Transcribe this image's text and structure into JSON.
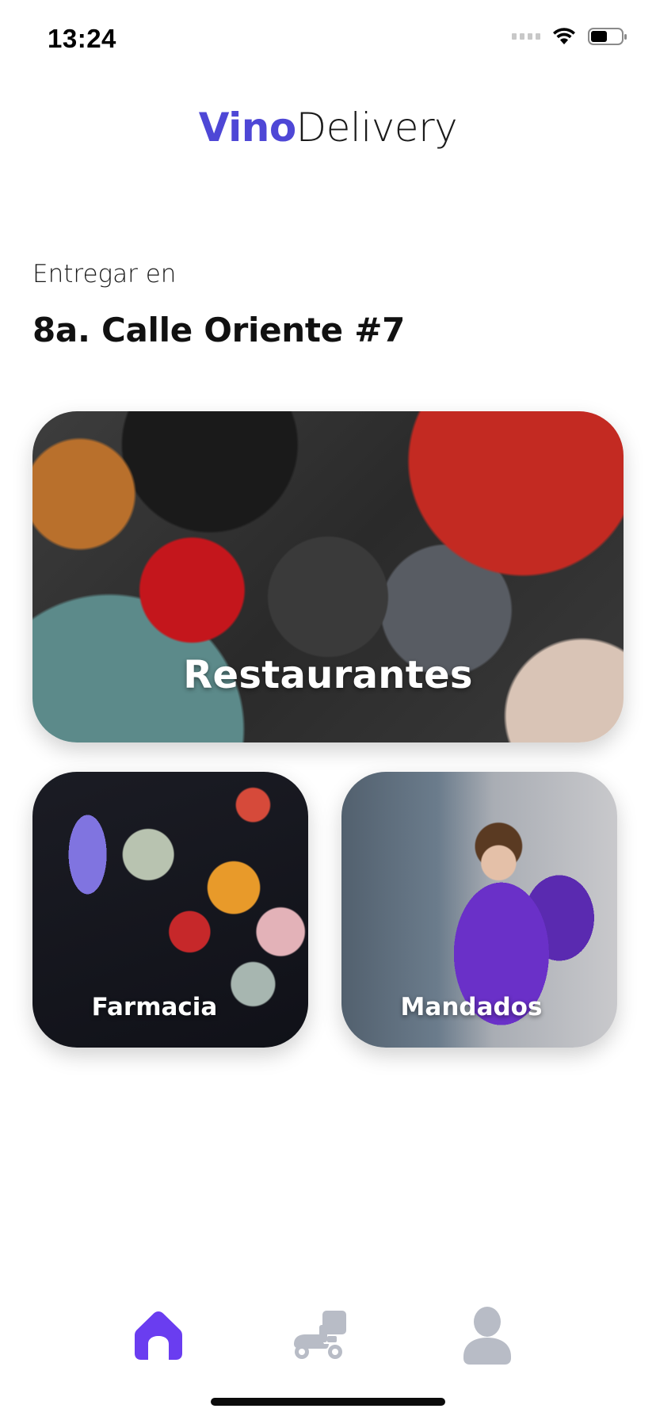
{
  "status_bar": {
    "time": "13:24",
    "icons": [
      "cellular-signal-icon",
      "wifi-icon",
      "battery-icon"
    ]
  },
  "header": {
    "brand_primary": "Vino",
    "brand_secondary": "Delivery",
    "brand_color": "#4e47d6"
  },
  "delivery": {
    "label": "Entregar en",
    "address": "8a. Calle Oriente #7"
  },
  "categories": {
    "restaurants": {
      "label": "Restaurantes"
    },
    "pharmacy": {
      "label": "Farmacia"
    },
    "errands": {
      "label": "Mandados"
    }
  },
  "bottom_nav": {
    "items": [
      {
        "icon": "home-icon",
        "active": true,
        "color": "#6a3df0"
      },
      {
        "icon": "delivery-scooter-icon",
        "active": false,
        "color": "#b8bcc6"
      },
      {
        "icon": "user-profile-icon",
        "active": false,
        "color": "#b8bcc6"
      }
    ]
  }
}
